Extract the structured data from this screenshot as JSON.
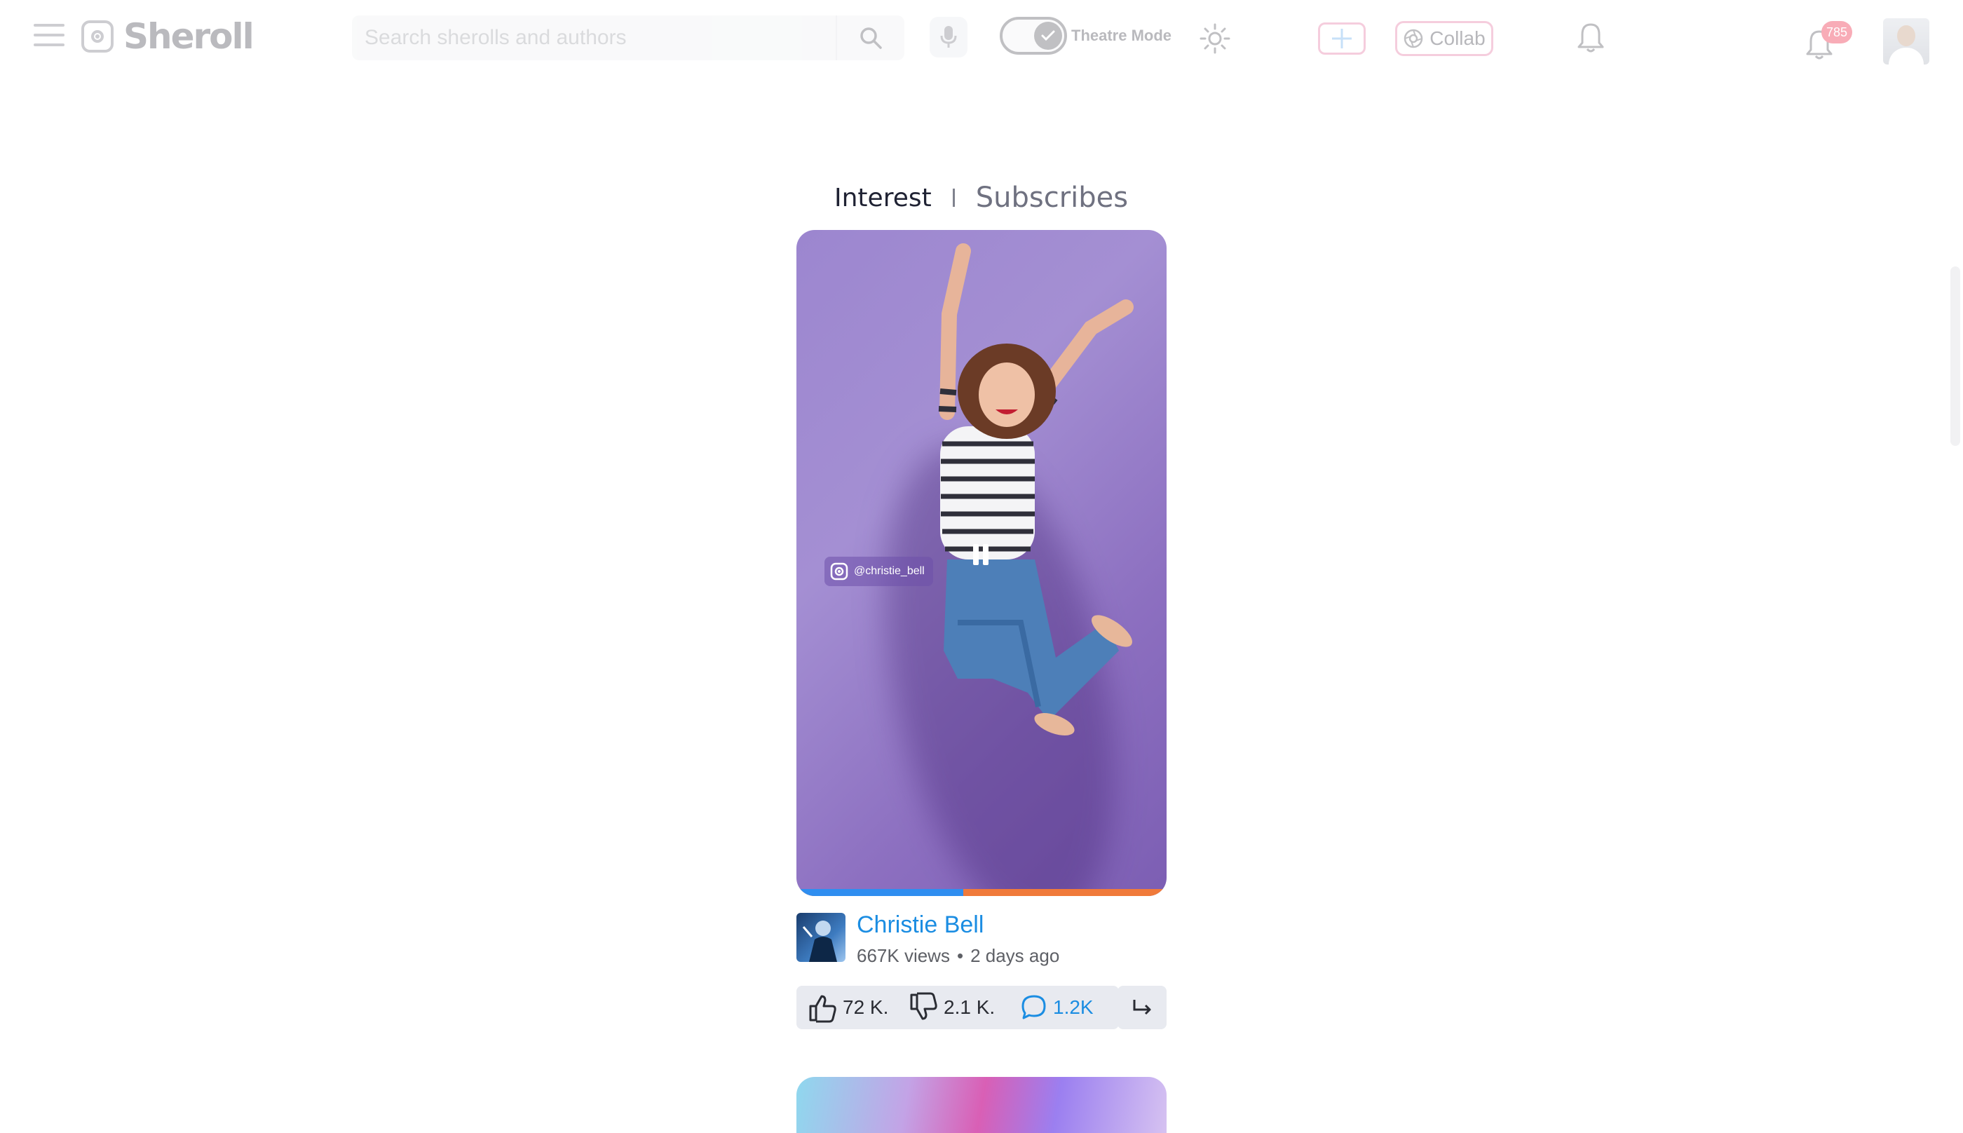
{
  "app": {
    "name": "Sheroll"
  },
  "header": {
    "search_placeholder": "Search sherolls and authors",
    "theatre_mode_label": "Theatre Mode",
    "theatre_mode_on": true,
    "collab_label": "Collab",
    "notification_count": "785"
  },
  "tabs": {
    "active": "Interest",
    "inactive": "Subscribes"
  },
  "video": {
    "handle": "@christie_bell",
    "progress": 0.45,
    "author": "Christie Bell",
    "views": "667K views",
    "age": "2 days ago",
    "likes": "72 K.",
    "dislikes": "2.1 K.",
    "comments": "1.2K"
  },
  "colors": {
    "accent": "#1b8de2",
    "progress_played": "#2f8ef0",
    "progress_rest": "#f07a3a",
    "badge": "#ef3b55"
  }
}
